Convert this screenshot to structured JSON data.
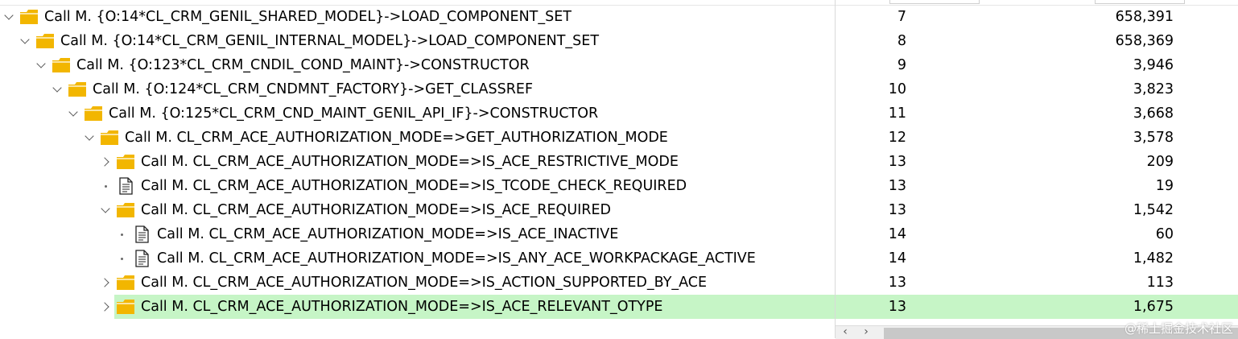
{
  "rows": [
    {
      "id": "r1",
      "label": "Call M. {O:14*CL_CRM_GENIL_SHARED_MODEL}->LOAD_COMPONENT_SET",
      "level": "7",
      "value": "658,391"
    },
    {
      "id": "r2",
      "label": "Call M. {O:14*CL_CRM_GENIL_INTERNAL_MODEL}->LOAD_COMPONENT_SET",
      "level": "8",
      "value": "658,369"
    },
    {
      "id": "r3",
      "label": "Call M. {O:123*CL_CRM_CNDIL_COND_MAINT}->CONSTRUCTOR",
      "level": "9",
      "value": "3,946"
    },
    {
      "id": "r4",
      "label": "Call M. {O:124*CL_CRM_CNDMNT_FACTORY}->GET_CLASSREF",
      "level": "10",
      "value": "3,823"
    },
    {
      "id": "r5",
      "label": "Call M. {O:125*CL_CRM_CND_MAINT_GENIL_API_IF}->CONSTRUCTOR",
      "level": "11",
      "value": "3,668"
    },
    {
      "id": "r6",
      "label": "Call M. CL_CRM_ACE_AUTHORIZATION_MODE=>GET_AUTHORIZATION_MODE",
      "level": "12",
      "value": "3,578"
    },
    {
      "id": "r7",
      "label": "Call M. CL_CRM_ACE_AUTHORIZATION_MODE=>IS_ACE_RESTRICTIVE_MODE",
      "level": "13",
      "value": "209"
    },
    {
      "id": "r8",
      "label": "Call M. CL_CRM_ACE_AUTHORIZATION_MODE=>IS_TCODE_CHECK_REQUIRED",
      "level": "13",
      "value": "19"
    },
    {
      "id": "r9",
      "label": "Call M. CL_CRM_ACE_AUTHORIZATION_MODE=>IS_ACE_REQUIRED",
      "level": "13",
      "value": "1,542"
    },
    {
      "id": "r10",
      "label": "Call M. CL_CRM_ACE_AUTHORIZATION_MODE=>IS_ACE_INACTIVE",
      "level": "14",
      "value": "60"
    },
    {
      "id": "r11",
      "label": "Call M. CL_CRM_ACE_AUTHORIZATION_MODE=>IS_ANY_ACE_WORKPACKAGE_ACTIVE",
      "level": "14",
      "value": "1,482"
    },
    {
      "id": "r12",
      "label": "Call M. CL_CRM_ACE_AUTHORIZATION_MODE=>IS_ACTION_SUPPORTED_BY_ACE",
      "level": "13",
      "value": "113"
    },
    {
      "id": "r13",
      "label": "Call M. CL_CRM_ACE_AUTHORIZATION_MODE=>IS_ACE_RELEVANT_OTYPE",
      "level": "13",
      "value": "1,675"
    }
  ],
  "icons": {
    "folder": "folder-icon",
    "document": "document-icon",
    "expanded": "chevron-down-icon",
    "collapsed": "chevron-right-icon",
    "leaf": "leaf-dot-icon"
  },
  "colors": {
    "folder": "#f2b600",
    "selection": "#c6f5c6",
    "document_stroke": "#222222"
  },
  "watermark": "@稀土掘金技术社区"
}
